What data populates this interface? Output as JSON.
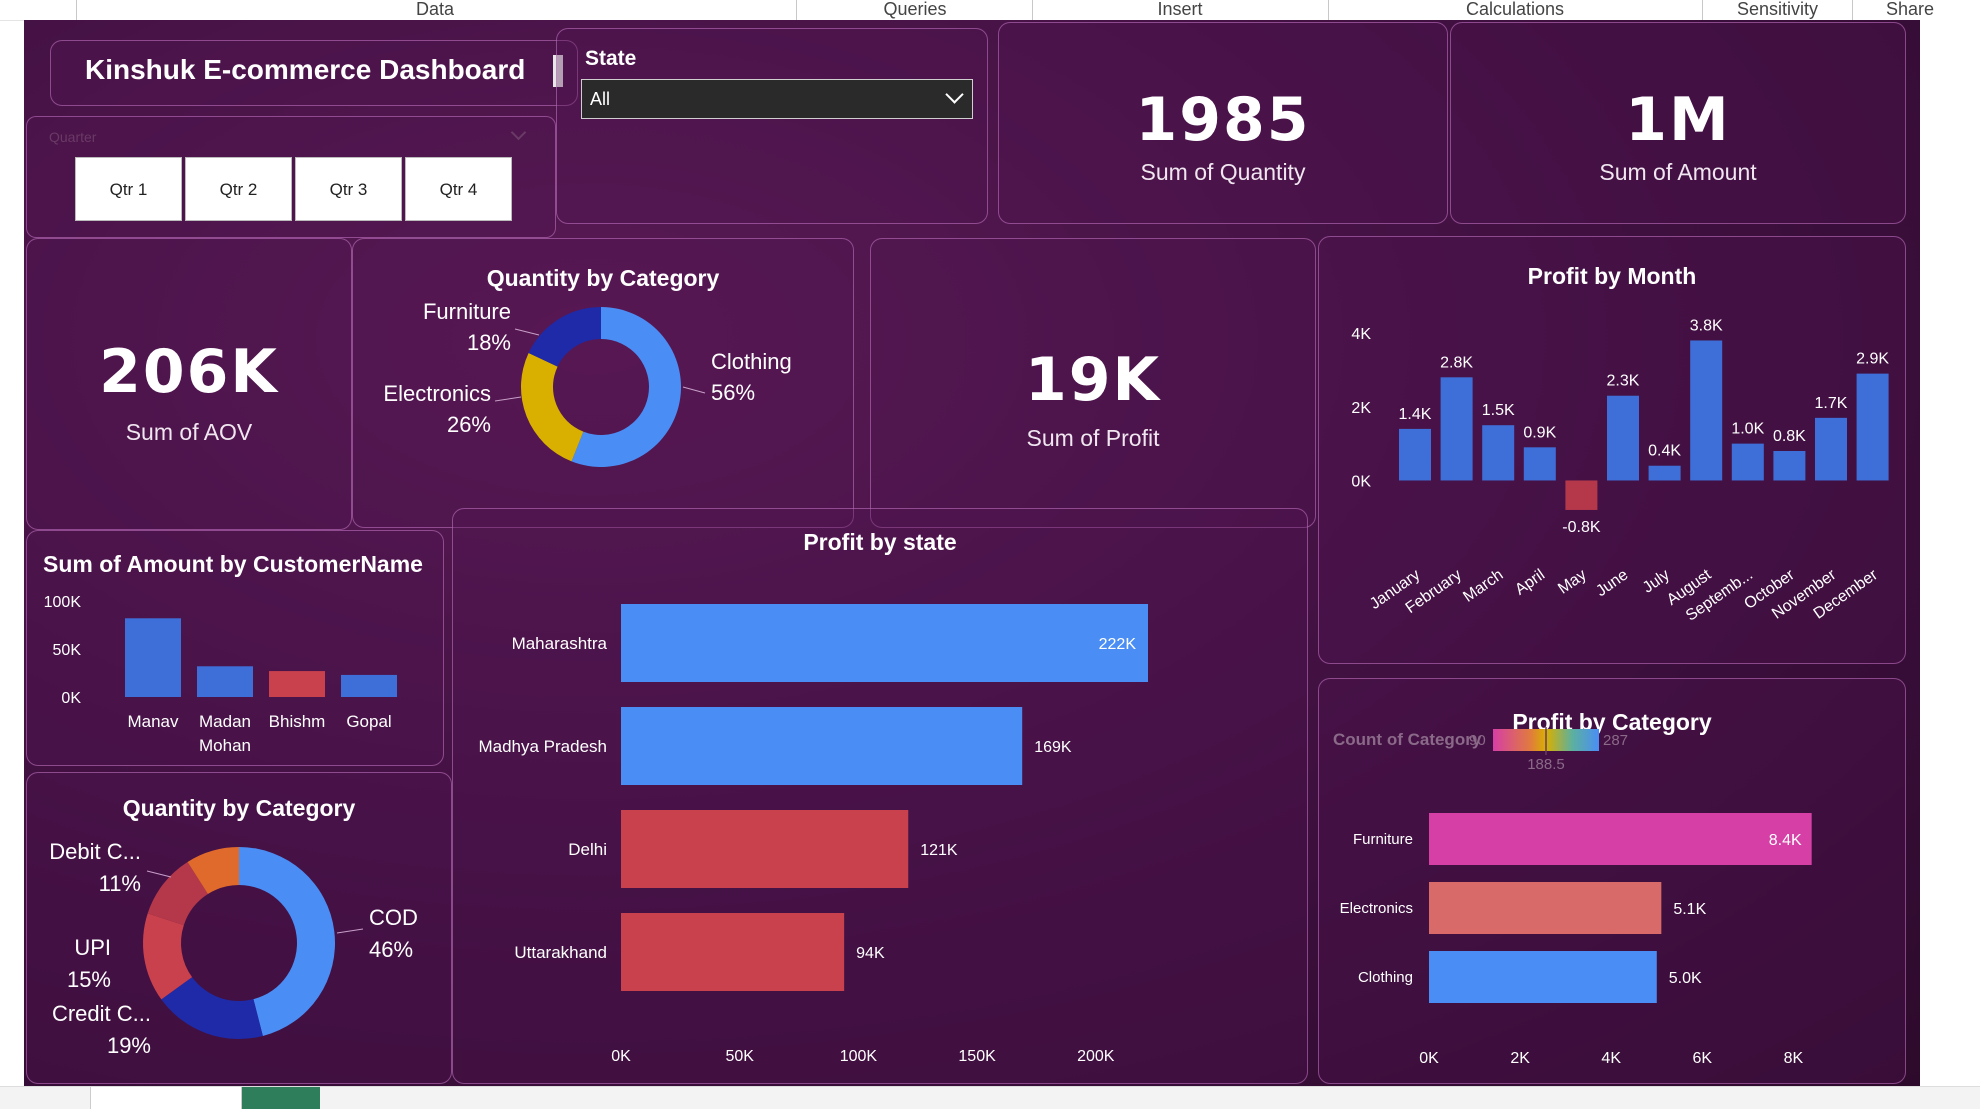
{
  "menu": {
    "items": [
      "Data",
      "Queries",
      "Insert",
      "Calculations",
      "Sensitivity",
      "Share"
    ]
  },
  "dashboard": {
    "title": "Kinshuk E-commerce Dashboard"
  },
  "quarter_slicer": {
    "label": "Quarter",
    "options": [
      "Qtr 1",
      "Qtr 2",
      "Qtr 3",
      "Qtr 4"
    ]
  },
  "state_filter": {
    "label": "State",
    "selected": "All"
  },
  "kpis": {
    "quantity": {
      "value": "1985",
      "label": "Sum of Quantity"
    },
    "amount": {
      "value": "1M",
      "label": "Sum of Amount"
    },
    "aov": {
      "value": "206K",
      "label": "Sum of AOV"
    },
    "profit": {
      "value": "19K",
      "label": "Sum of Profit"
    }
  },
  "colors": {
    "accent_blue": "#4a8ef5",
    "bar_blue": "#3e6fd8",
    "red": "#c9414d",
    "dark_red": "#b5384a",
    "yellow": "#d9b000",
    "navy": "#1f2aa8",
    "orange": "#e06a2c",
    "pink": "#d63fa6",
    "salmon": "#d96a6a"
  },
  "chart_data": [
    {
      "id": "quantity-by-category",
      "type": "pie",
      "title": "Quantity by Category",
      "slices": [
        {
          "label": "Clothing",
          "value": 56,
          "display": "56%",
          "color": "#4a8ef5"
        },
        {
          "label": "Electronics",
          "value": 26,
          "display": "26%",
          "color": "#d9b000"
        },
        {
          "label": "Furniture",
          "value": 18,
          "display": "18%",
          "color": "#1f2aa8"
        }
      ]
    },
    {
      "id": "profit-by-month",
      "type": "bar",
      "title": "Profit by Month",
      "categories": [
        "January",
        "February",
        "March",
        "April",
        "May",
        "June",
        "July",
        "August",
        "Septemb...",
        "October",
        "November",
        "December"
      ],
      "values": [
        1.4,
        2.8,
        1.5,
        0.9,
        -0.8,
        2.3,
        0.4,
        3.8,
        1.0,
        0.8,
        1.7,
        2.9
      ],
      "labels": [
        "1.4K",
        "2.8K",
        "1.5K",
        "0.9K",
        "-0.8K",
        "2.3K",
        "0.4K",
        "3.8K",
        "1.0K",
        "0.8K",
        "1.7K",
        "2.9K"
      ],
      "yticks": [
        0,
        2,
        4
      ],
      "ytick_labels": [
        "0K",
        "2K",
        "4K"
      ],
      "ylim": [
        -1.1,
        4.6
      ]
    },
    {
      "id": "amount-by-customer",
      "type": "bar",
      "title": "Sum of Amount by CustomerName",
      "categories": [
        "Manav",
        "Madan Mohan",
        "Bhishm",
        "Gopal"
      ],
      "category_lines": [
        [
          "Manav"
        ],
        [
          "Madan",
          "Mohan"
        ],
        [
          "Bhishm"
        ],
        [
          "Gopal"
        ]
      ],
      "values": [
        82,
        32,
        27,
        23
      ],
      "colors": [
        "#3e6fd8",
        "#3e6fd8",
        "#c9414d",
        "#3e6fd8"
      ],
      "yticks": [
        0,
        50,
        100
      ],
      "ytick_labels": [
        "0K",
        "50K",
        "100K"
      ],
      "ylim": [
        0,
        100
      ]
    },
    {
      "id": "profit-by-state",
      "type": "bar",
      "orientation": "horizontal",
      "title": "Profit by state",
      "categories": [
        "Maharashtra",
        "Madhya Pradesh",
        "Delhi",
        "Uttarakhand"
      ],
      "values": [
        222,
        169,
        121,
        94
      ],
      "labels": [
        "222K",
        "169K",
        "121K",
        "94K"
      ],
      "colors": [
        "#4a8ef5",
        "#4a8ef5",
        "#c9414d",
        "#c9414d"
      ],
      "xticks": [
        0,
        50,
        100,
        150,
        200
      ],
      "xtick_labels": [
        "0K",
        "50K",
        "100K",
        "150K",
        "200K"
      ],
      "xlim": [
        0,
        230
      ]
    },
    {
      "id": "payment-mode-donut",
      "type": "pie",
      "title": "Quantity by Category",
      "slices": [
        {
          "label": "COD",
          "value": 46,
          "display": "46%",
          "color": "#4a8ef5"
        },
        {
          "label": "Credit C...",
          "value": 19,
          "display": "19%",
          "color": "#1f2aa8"
        },
        {
          "label": "UPI",
          "value": 15,
          "display": "15%",
          "color": "#c9414d"
        },
        {
          "label": "Debit C...",
          "value": 11,
          "display": "11%",
          "color": "#b5384a"
        },
        {
          "label": "",
          "value": 9,
          "display": "",
          "color": "#e06a2c"
        }
      ]
    },
    {
      "id": "profit-by-category",
      "type": "bar",
      "orientation": "horizontal",
      "title": "Profit by Category",
      "categories": [
        "Furniture",
        "Electronics",
        "Clothing"
      ],
      "values": [
        8.4,
        5.1,
        5.0
      ],
      "labels": [
        "8.4K",
        "5.1K",
        "5.0K"
      ],
      "colors": [
        "#d63fa6",
        "#d96a6a",
        "#4a8ef5"
      ],
      "xticks": [
        0,
        2,
        4,
        6,
        8
      ],
      "xtick_labels": [
        "0K",
        "2K",
        "4K",
        "6K",
        "8K"
      ],
      "xlim": [
        0,
        9
      ],
      "legend": {
        "title": "Count of Category",
        "min": "90",
        "mid": "188.5",
        "max": "287"
      }
    }
  ]
}
